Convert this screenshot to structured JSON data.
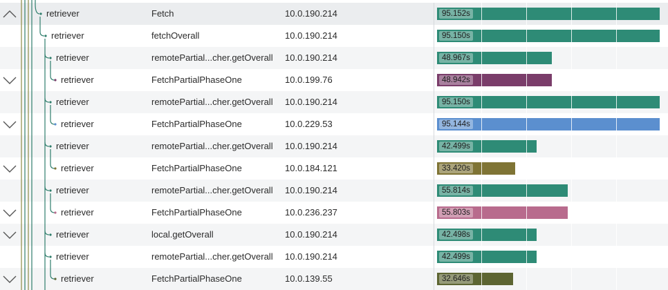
{
  "colors": {
    "teal": "#2e8b76",
    "purple": "#7a3d6a",
    "blue": "#5b8fcf",
    "olive": "#7f7435",
    "pink": "#b86b8d",
    "dark_olive": "#5d6532",
    "tree_green": "#2e7d6b",
    "tree_olive": "#8c8a45"
  },
  "rows": [
    {
      "service": "retriever",
      "operation": "Fetch",
      "host": "10.0.190.214",
      "duration": "95.152s",
      "fraction": 1.0,
      "color": "#2e8b76",
      "expandable": true,
      "expanded": true,
      "depth": 0
    },
    {
      "service": "retriever",
      "operation": "fetchOverall",
      "host": "10.0.190.214",
      "duration": "95.150s",
      "fraction": 1.0,
      "color": "#2e8b76",
      "expandable": false,
      "expanded": false,
      "depth": 1
    },
    {
      "service": "retriever",
      "operation": "remotePartial...cher.getOverall",
      "host": "10.0.190.214",
      "duration": "48.967s",
      "fraction": 0.515,
      "color": "#2e8b76",
      "expandable": false,
      "expanded": false,
      "depth": 2
    },
    {
      "service": "retriever",
      "operation": "FetchPartialPhaseOne",
      "host": "10.0.199.76",
      "duration": "48.942s",
      "fraction": 0.514,
      "color": "#7a3d6a",
      "expandable": true,
      "expanded": false,
      "depth": 3
    },
    {
      "service": "retriever",
      "operation": "remotePartial...cher.getOverall",
      "host": "10.0.190.214",
      "duration": "95.150s",
      "fraction": 1.0,
      "color": "#2e8b76",
      "expandable": false,
      "expanded": false,
      "depth": 2
    },
    {
      "service": "retriever",
      "operation": "FetchPartialPhaseOne",
      "host": "10.0.229.53",
      "duration": "95.144s",
      "fraction": 1.0,
      "color": "#5b8fcf",
      "expandable": true,
      "expanded": false,
      "depth": 3
    },
    {
      "service": "retriever",
      "operation": "remotePartial...cher.getOverall",
      "host": "10.0.190.214",
      "duration": "42.499s",
      "fraction": 0.447,
      "color": "#2e8b76",
      "expandable": false,
      "expanded": false,
      "depth": 2
    },
    {
      "service": "retriever",
      "operation": "FetchPartialPhaseOne",
      "host": "10.0.184.121",
      "duration": "33.420s",
      "fraction": 0.351,
      "color": "#7f7435",
      "expandable": true,
      "expanded": false,
      "depth": 3
    },
    {
      "service": "retriever",
      "operation": "remotePartial...cher.getOverall",
      "host": "10.0.190.214",
      "duration": "55.814s",
      "fraction": 0.587,
      "color": "#2e8b76",
      "expandable": false,
      "expanded": false,
      "depth": 2
    },
    {
      "service": "retriever",
      "operation": "FetchPartialPhaseOne",
      "host": "10.0.236.237",
      "duration": "55.803s",
      "fraction": 0.586,
      "color": "#b86b8d",
      "expandable": true,
      "expanded": false,
      "depth": 3
    },
    {
      "service": "retriever",
      "operation": "local.getOverall",
      "host": "10.0.190.214",
      "duration": "42.498s",
      "fraction": 0.447,
      "color": "#2e8b76",
      "expandable": true,
      "expanded": false,
      "depth": 2
    },
    {
      "service": "retriever",
      "operation": "remotePartial...cher.getOverall",
      "host": "10.0.190.214",
      "duration": "42.499s",
      "fraction": 0.447,
      "color": "#2e8b76",
      "expandable": false,
      "expanded": false,
      "depth": 2
    },
    {
      "service": "retriever",
      "operation": "FetchPartialPhaseOne",
      "host": "10.0.139.55",
      "duration": "32.646s",
      "fraction": 0.343,
      "color": "#5d6532",
      "expandable": true,
      "expanded": false,
      "depth": 3
    }
  ]
}
